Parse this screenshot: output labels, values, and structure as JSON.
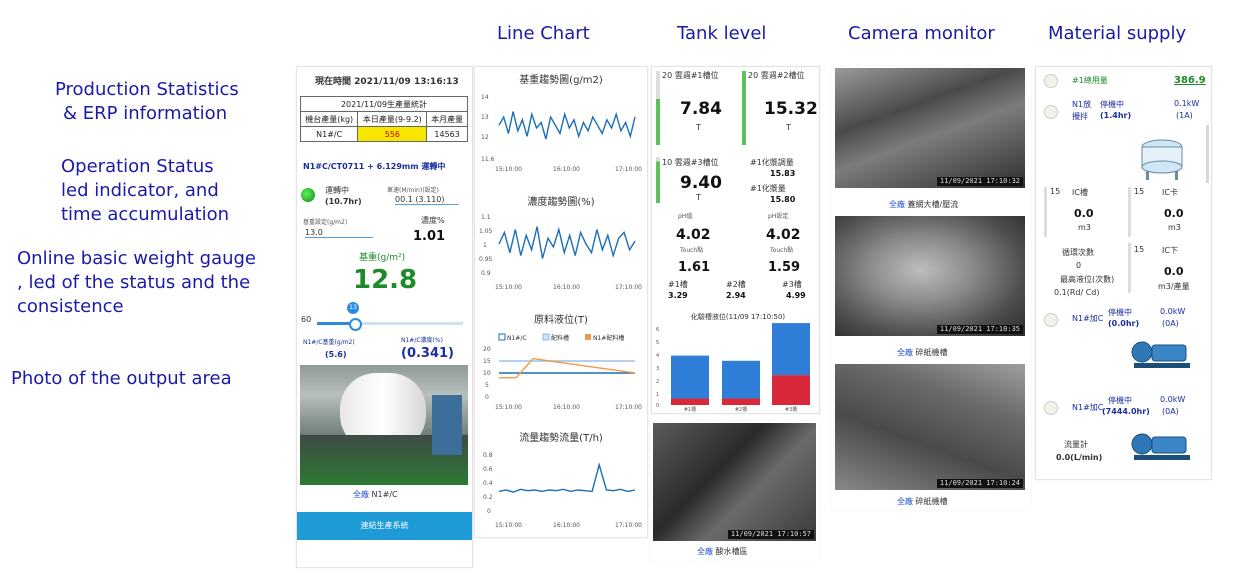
{
  "annotations": {
    "production": [
      "Production Statistics",
      "& ERP information"
    ],
    "operation": [
      "Operation Status",
      "led indicator, and",
      "time accumulation"
    ],
    "gauge": [
      "Online basic weight gauge",
      ", led of the status and the",
      "consistence"
    ],
    "photo": "Photo of the output area"
  },
  "column_heads": {
    "line_chart": "Line Chart",
    "tank_level": "Tank level",
    "camera_monitor": "Camera monitor",
    "material_supply": "Material supply"
  },
  "production_panel": {
    "time_label": "現在時間 2021/11/09 13:16:13",
    "table_title": "2021/11/09生產量統計",
    "headers": [
      "機台產量(kg)",
      "本日產量(9-9.2)",
      "本月產量"
    ],
    "row": [
      "N1#/C",
      "556",
      "14563"
    ],
    "machine_line": "N1#C/CT0711 + 6.129mm 運轉中",
    "status_word": "運轉中",
    "status_hours": "(10.7hr)",
    "speed_label": "車速(M/min)(設定)",
    "speed_value": "00.1 (3.110)",
    "basis_label": "基重設定(g/m2)",
    "basis_value": "13.0",
    "consist_label": "濃度%",
    "consist_value": "1.01",
    "gauge_title": "基重(g/m²)",
    "gauge_value": "12.8",
    "slider_min": "60",
    "slider_bubble": "13",
    "bottom_left_label": "N1#/C基重(g/m2)",
    "bottom_left_value": "(5.6)",
    "bottom_right_label": "N1#/C濃度(%)",
    "bottom_right_value": "(0.341)",
    "photo_caption_link": "全廠",
    "photo_caption_text": "N1#/C",
    "button_label": "連結生產系統"
  },
  "charts": [
    {
      "title": "基重趨勢圖(g/m2)",
      "yticks": [
        "14",
        "13",
        "12",
        "11.6"
      ],
      "xticks": [
        "15:10:00",
        "16:10:00",
        "17:10:00"
      ]
    },
    {
      "title": "濃度趨勢圖(%)",
      "yticks": [
        "1.1",
        "1.05",
        "1",
        "0.95",
        "0.9"
      ],
      "xticks": [
        "15:10:00",
        "16:10:00",
        "17:10:00"
      ]
    },
    {
      "title": "原料液位(T)",
      "legend": [
        "N1#/C",
        "配料槽",
        "N1#配料槽"
      ],
      "yticks": [
        "20",
        "15",
        "10",
        "5",
        "0"
      ],
      "xticks": [
        "15:10:00",
        "16:10:00",
        "17:10:00"
      ]
    },
    {
      "title": "流量趨勢流量(T/h)",
      "yticks": [
        "0.8",
        "0.6",
        "0.4",
        "0.2",
        "0"
      ],
      "xticks": [
        "15:10:00",
        "16:10:00",
        "17:10:00"
      ]
    }
  ],
  "chart_data": [
    {
      "type": "line",
      "title": "基重趨勢圖(g/m2)",
      "xlabel": "",
      "ylabel": "",
      "ylim": [
        11.6,
        14
      ],
      "x": [
        "15:10:00",
        "16:10:00",
        "17:10:00"
      ],
      "series": [
        {
          "values": [
            12.9,
            13.2,
            12.6,
            13.4,
            12.7,
            13.1,
            12.5,
            13.3,
            12.8,
            13.0,
            12.4,
            13.2,
            12.9,
            12.6,
            13.3,
            12.8,
            13.1,
            12.5,
            13.0,
            12.7,
            13.2,
            12.9,
            12.6,
            13.1,
            12.8,
            13.3,
            12.7,
            13.0,
            12.5,
            13.2
          ]
        }
      ]
    },
    {
      "type": "line",
      "title": "濃度趨勢圖(%)",
      "xlabel": "",
      "ylabel": "",
      "ylim": [
        0.9,
        1.1
      ],
      "x": [
        "15:10:00",
        "16:10:00",
        "17:10:00"
      ],
      "series": [
        {
          "values": [
            1.0,
            1.04,
            0.97,
            1.05,
            0.96,
            1.03,
            0.98,
            1.06,
            0.95,
            1.02,
            0.99,
            1.05,
            0.97,
            1.03,
            0.96,
            1.04,
            1.0,
            0.97,
            1.05,
            0.98,
            1.03,
            0.96,
            1.02,
            1.04,
            0.98,
            1.01
          ]
        }
      ]
    },
    {
      "type": "line",
      "title": "原料液位(T)",
      "xlabel": "",
      "ylabel": "",
      "ylim": [
        0,
        20
      ],
      "x": [
        "15:10:00",
        "16:10:00",
        "17:10:00"
      ],
      "series": [
        {
          "name": "N1#/C",
          "values": [
            10,
            10,
            10,
            10,
            10,
            10,
            10,
            10,
            10
          ]
        },
        {
          "name": "配料槽",
          "values": [
            15,
            15,
            15,
            15,
            15,
            15,
            15,
            15,
            15
          ]
        },
        {
          "name": "N1#配料槽",
          "values": [
            8,
            8,
            16,
            15,
            14,
            13,
            12,
            11,
            10
          ]
        }
      ]
    },
    {
      "type": "line",
      "title": "流量趨勢流量(T/h)",
      "xlabel": "",
      "ylabel": "",
      "ylim": [
        0,
        0.8
      ],
      "x": [
        "15:10:00",
        "16:10:00",
        "17:10:00"
      ],
      "series": [
        {
          "values": [
            0.28,
            0.3,
            0.27,
            0.31,
            0.29,
            0.3,
            0.28,
            0.3,
            0.29,
            0.31,
            0.28,
            0.3,
            0.29,
            0.28,
            0.66,
            0.3,
            0.29,
            0.31,
            0.28,
            0.3
          ]
        }
      ]
    },
    {
      "type": "bar",
      "title": "化驗槽液位(11/09 17:10:50)",
      "categories": [
        "#1槽",
        "#2槽",
        "#3槽"
      ],
      "series": [
        {
          "name": "",
          "values": [
            3.3,
            2.9,
            4.0
          ]
        },
        {
          "name": "",
          "values": [
            0.5,
            0.5,
            2.3
          ]
        }
      ]
    }
  ],
  "tank_panel": {
    "t1_label": "20 雲週#1槽位",
    "t1_value": "7.84",
    "t1_unit": "T",
    "t2_label": "20 雲週#2槽位",
    "t2_value": "15.32",
    "t2_unit": "T",
    "t3_label": "10 雲週#3槽位",
    "t3_value": "9.40",
    "t3_unit": "T",
    "r1_label": "#1化漿調量",
    "r1_value": "15.83",
    "r2_label": "#1化漿量",
    "r2_value": "15.80",
    "a_label": "pH值",
    "a_value": "4.02",
    "a_sub": "Touch點",
    "b_label": "pH設定",
    "b_value": "4.02",
    "b_sub": "Touch點",
    "c_value": "1.61",
    "d_value": "1.59",
    "m1_label": "#1槽",
    "m1_value": "3.29",
    "m2_label": "#2槽",
    "m2_value": "2.94",
    "m3_label": "#3槽",
    "m3_value": "4.99",
    "bar_title": "化驗槽液位(11/09 17:10:50)",
    "bar_cats": [
      "#1槽",
      "#2槽",
      "#3槽"
    ],
    "bar_yticks": [
      "6",
      "5",
      "4",
      "3",
      "2",
      "1",
      "0"
    ],
    "cam_caption_link": "全廠",
    "cam_caption_text": "酸水槽區",
    "cam_time": "11/09/2021 17:10:57"
  },
  "camera_panel": {
    "items": [
      {
        "link": "全廠",
        "text": "蓋網大槽/壓流",
        "time": "11/09/2021 17:10:32"
      },
      {
        "link": "全廠",
        "text": "碎紙機槽",
        "time": "11/09/2021 17:10:35"
      },
      {
        "link": "全廠",
        "text": "碎紙機槽",
        "time": "11/09/2021 17:10:24"
      }
    ]
  },
  "material_panel": {
    "top_label": "#1總用量",
    "top_value": "386.9",
    "m1_name": "N1放",
    "m1_state": "停機中",
    "m1_power": "0.1kW",
    "m1_hours": "(1.4hr)",
    "m1_amp": "(1A)",
    "m1_sub": "攪拌",
    "g1_label": "IC槽",
    "g1_value": "0.0",
    "g1_unit": "m3",
    "g2_label": "IC卡",
    "g2_value": "0.0",
    "g2_unit": "m3",
    "g3_label": "IC下",
    "g3_value": "0.0",
    "g3_unit": "m3/產量",
    "gauge_tick": "15",
    "cnt_label": "循環次數",
    "cnt_value": "0",
    "max_label": "最高液位(次數)",
    "max_value": "0.1(Rd/ Cd)",
    "p1_name": "N1#加C",
    "p1_state": "停機中",
    "p1_power": "0.0kW",
    "p1_hours": "(0.0hr)",
    "p1_amp": "(0A)",
    "p2_name": "N1#加C",
    "p2_state": "停機中",
    "p2_power": "0.0kW",
    "p2_hours": "(7444.0hr)",
    "p2_amp": "(0A)",
    "flow_label": "流量計",
    "flow_value": "0.0(L/min)"
  },
  "colors": {
    "accent": "#1a1aa8",
    "brand_button": "#1e9ad6",
    "line": "#1a6fb8",
    "green_value": "#1e8a2a",
    "bar_blue": "#2f7fd8",
    "bar_red": "#d8283a",
    "highlight": "#f7e600"
  }
}
